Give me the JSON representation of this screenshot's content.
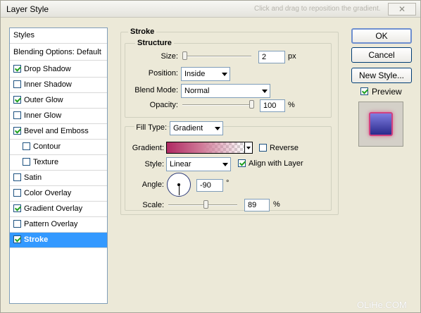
{
  "window": {
    "title": "Layer Style",
    "hint": "Click and drag to reposition the gradient."
  },
  "styles": {
    "header": "Styles",
    "blending": "Blending Options: Default",
    "items": [
      {
        "label": "Drop Shadow",
        "checked": true
      },
      {
        "label": "Inner Shadow",
        "checked": false
      },
      {
        "label": "Outer Glow",
        "checked": true
      },
      {
        "label": "Inner Glow",
        "checked": false
      },
      {
        "label": "Bevel and Emboss",
        "checked": true
      },
      {
        "label": "Contour",
        "checked": false
      },
      {
        "label": "Texture",
        "checked": false
      },
      {
        "label": "Satin",
        "checked": false
      },
      {
        "label": "Color Overlay",
        "checked": false
      },
      {
        "label": "Gradient Overlay",
        "checked": true
      },
      {
        "label": "Pattern Overlay",
        "checked": false
      },
      {
        "label": "Stroke",
        "checked": true
      }
    ]
  },
  "stroke": {
    "section_title": "Stroke",
    "structure_title": "Structure",
    "size_label": "Size:",
    "size_value": "2",
    "size_unit": "px",
    "position_label": "Position:",
    "position_value": "Inside",
    "blend_label": "Blend Mode:",
    "blend_value": "Normal",
    "opacity_label": "Opacity:",
    "opacity_value": "100",
    "opacity_unit": "%",
    "fill_type_label": "Fill Type:",
    "fill_type_value": "Gradient",
    "gradient_label": "Gradient:",
    "reverse_label": "Reverse",
    "style_label": "Style:",
    "style_value": "Linear",
    "align_label": "Align with Layer",
    "angle_label": "Angle:",
    "angle_value": "-90",
    "angle_unit": "°",
    "scale_label": "Scale:",
    "scale_value": "89",
    "scale_unit": "%"
  },
  "buttons": {
    "ok": "OK",
    "cancel": "Cancel",
    "new_style": "New Style...",
    "preview": "Preview"
  },
  "watermark": "OLiHe.COM"
}
